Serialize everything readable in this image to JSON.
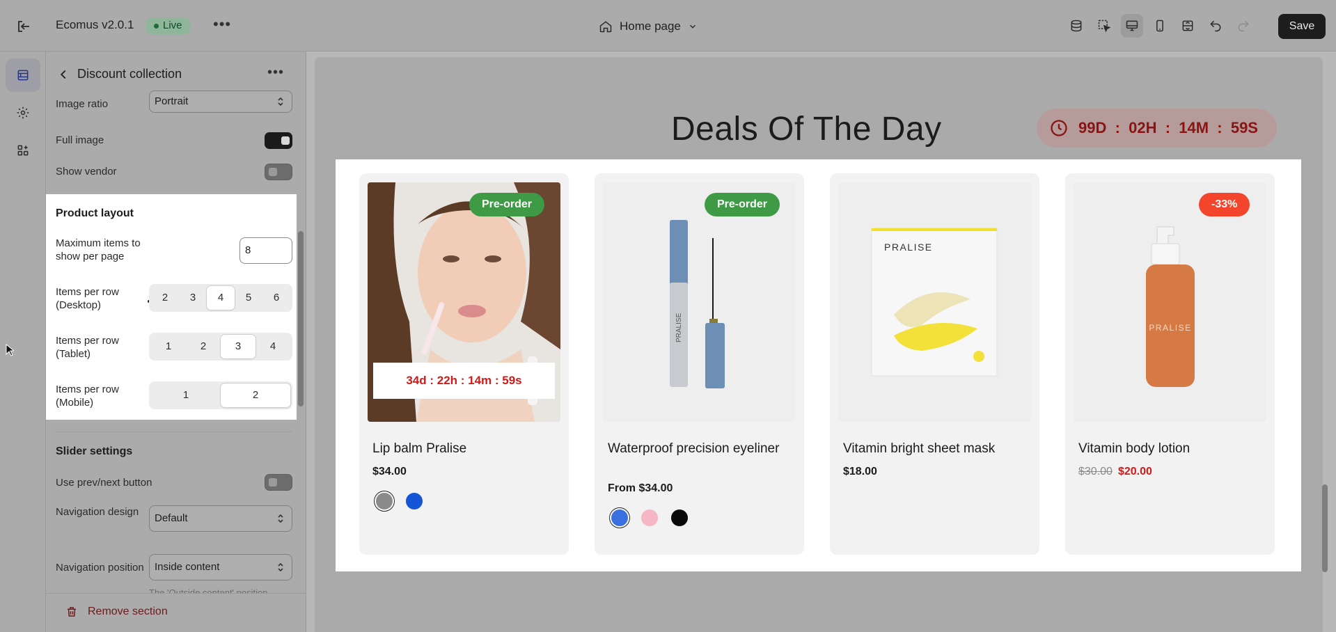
{
  "topbar": {
    "app_name": "Ecomus v2.0.1",
    "status": "Live",
    "page_selector": "Home page",
    "save_label": "Save"
  },
  "panel": {
    "title": "Discount collection",
    "image_ratio": {
      "label": "Image ratio",
      "value": "Portrait"
    },
    "full_image": {
      "label": "Full image",
      "on": true
    },
    "show_vendor": {
      "label": "Show vendor",
      "on": false
    },
    "product_layout": {
      "title": "Product layout",
      "max_items": {
        "label": "Maximum items to show per page",
        "value": "8"
      },
      "desktop": {
        "label": "Items per row (Desktop)",
        "options": [
          "2",
          "3",
          "4",
          "5",
          "6"
        ],
        "selected": "4"
      },
      "tablet": {
        "label": "Items per row (Tablet)",
        "options": [
          "1",
          "2",
          "3",
          "4"
        ],
        "selected": "3"
      },
      "mobile": {
        "label": "Items per row (Mobile)",
        "options": [
          "1",
          "2"
        ],
        "selected": "2"
      }
    },
    "slider_settings": {
      "title": "Slider settings",
      "prev_next": {
        "label": "Use prev/next button",
        "on": false
      },
      "nav_design": {
        "label": "Navigation design",
        "value": "Default"
      },
      "nav_position": {
        "label": "Navigation position",
        "value": "Inside content"
      },
      "hint": "The 'Outside content' position"
    },
    "remove_label": "Remove section"
  },
  "canvas": {
    "heading": "Deals Of The Day",
    "countdown": "99D  :  02H  :  14M  :  59S",
    "products": [
      {
        "badge": "Pre-order",
        "name": "Lip balm Pralise",
        "price": "$34.00",
        "timer": "34d : 22h : 14m : 59s",
        "swatches": [
          "#8a8a8a",
          "#1554d6"
        ]
      },
      {
        "badge": "Pre-order",
        "name": "Waterproof precision eyeliner",
        "price": "From $34.00",
        "swatches": [
          "#3a6fe0",
          "#f7b6c6",
          "#0a0a0a"
        ]
      },
      {
        "badge": "",
        "name": "Vitamin bright sheet mask",
        "price": "$18.00",
        "image_brand": "PRALISE"
      },
      {
        "badge": "-33%",
        "name": "Vitamin body lotion",
        "old_price": "$30.00",
        "price": "$20.00",
        "image_brand": "PRALISE"
      }
    ]
  },
  "colors": {
    "accent_live": "#1f6b3a",
    "preorder": "#3e9a44",
    "sale": "#f2452c",
    "price_red": "#d11a1a"
  }
}
